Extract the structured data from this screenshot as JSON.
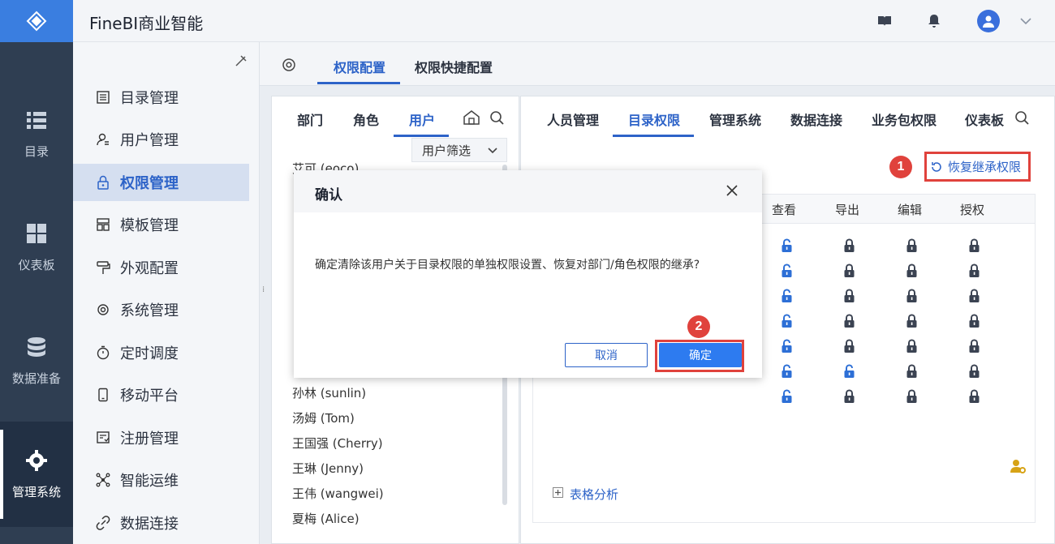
{
  "app": {
    "title": "FineBI商业智能"
  },
  "leftnav": [
    {
      "label": "目录",
      "icon": "list-icon"
    },
    {
      "label": "仪表板",
      "icon": "dashboard-icon"
    },
    {
      "label": "数据准备",
      "icon": "database-icon"
    },
    {
      "label": "管理系统",
      "icon": "gear-icon"
    }
  ],
  "sidebar": {
    "items": [
      {
        "label": "目录管理",
        "icon": "catalog-icon"
      },
      {
        "label": "用户管理",
        "icon": "user-icon"
      },
      {
        "label": "权限管理",
        "icon": "lock-icon"
      },
      {
        "label": "模板管理",
        "icon": "template-icon"
      },
      {
        "label": "外观配置",
        "icon": "brush-icon"
      },
      {
        "label": "系统管理",
        "icon": "gear-icon"
      },
      {
        "label": "定时调度",
        "icon": "timer-icon"
      },
      {
        "label": "移动平台",
        "icon": "mobile-icon"
      },
      {
        "label": "注册管理",
        "icon": "register-icon"
      },
      {
        "label": "智能运维",
        "icon": "network-icon"
      },
      {
        "label": "数据连接",
        "icon": "link-icon"
      }
    ]
  },
  "content_tabs": [
    "权限配置",
    "权限快捷配置"
  ],
  "user_panel": {
    "tabs": [
      "部门",
      "角色",
      "用户"
    ],
    "filter_label": "用户筛选",
    "users": [
      "艾可 (eoco)",
      "孙林 (sunlin)",
      "汤姆 (Tom)",
      "王国强 (Cherry)",
      "王琳 (Jenny)",
      "王伟 (wangwei)",
      "夏梅 (Alice)"
    ]
  },
  "perm_panel": {
    "tabs": [
      "人员管理",
      "目录权限",
      "管理系统",
      "数据连接",
      "业务包权限",
      "仪表板"
    ],
    "restore_label": "恢复继承权限",
    "columns": [
      "查看",
      "导出",
      "编辑",
      "授权"
    ],
    "visible_row_label": "表格分析"
  },
  "dialog": {
    "title": "确认",
    "message": "确定清除该用户关于目录权限的单独权限设置、恢复对部门/角色权限的继承?",
    "cancel_label": "取消",
    "ok_label": "确定"
  },
  "annotations": {
    "badge1": "1",
    "badge2": "2"
  },
  "colors": {
    "accent": "#2d63c8",
    "highlight": "#e0423c",
    "nav_bg": "#2f3e52"
  }
}
